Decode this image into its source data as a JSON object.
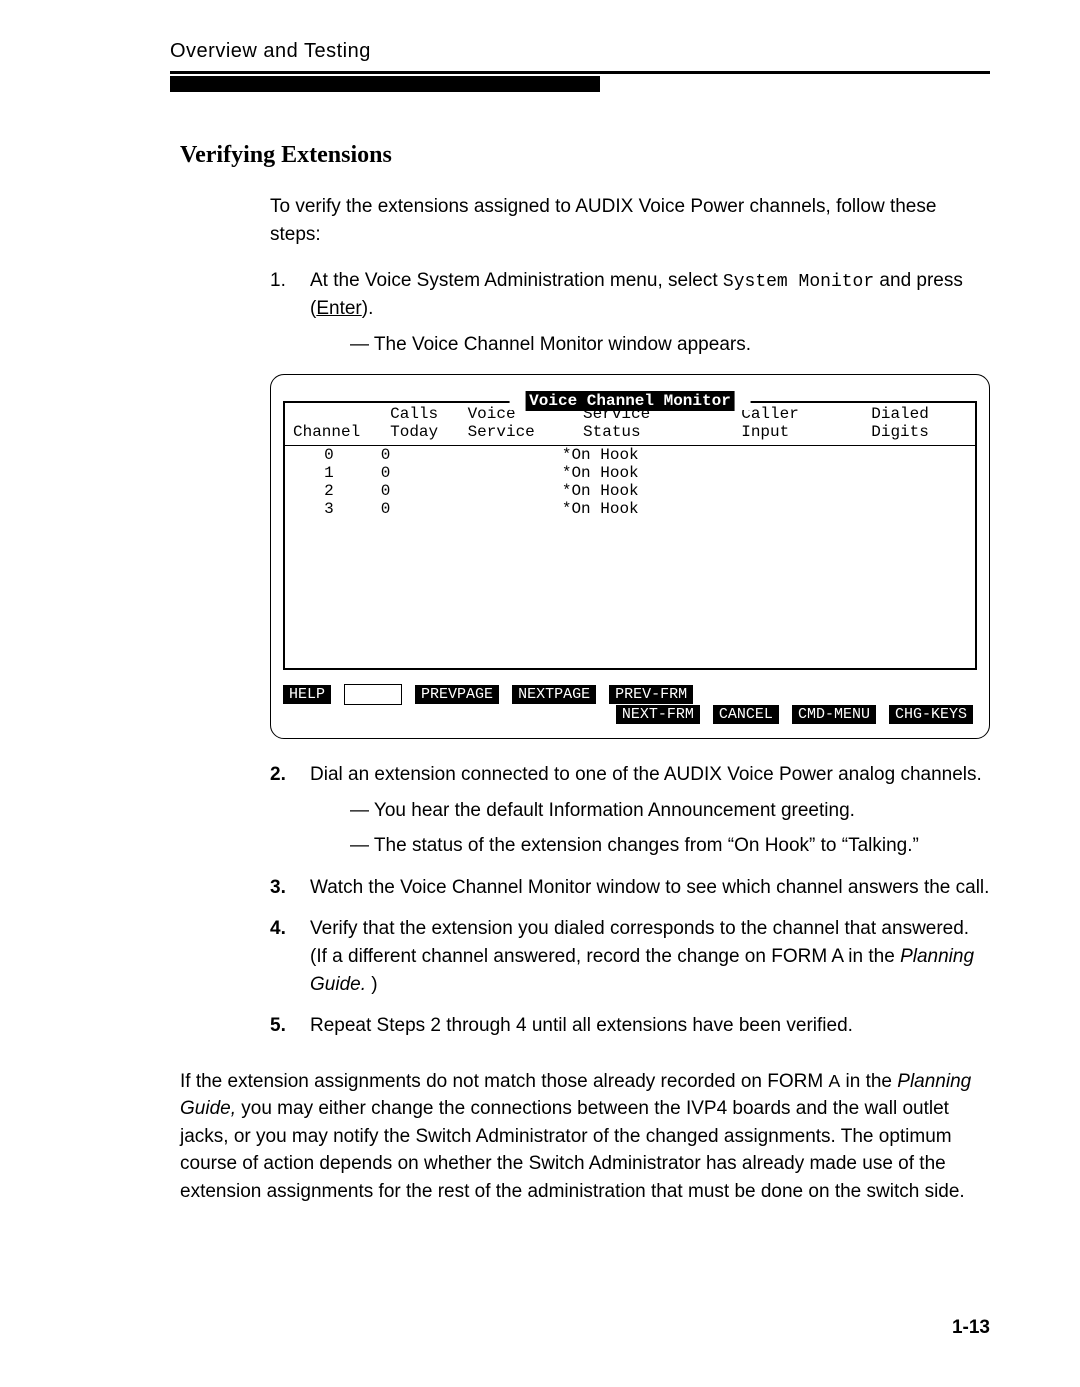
{
  "running_header": "Overview and Testing",
  "section_heading": "Verifying Extensions",
  "intro": "To verify the extensions assigned to AUDIX Voice Power channels, follow these steps:",
  "steps": [
    {
      "num": "1.",
      "num_weight": "light",
      "text_pre": "At the Voice System Administration menu, select ",
      "code": "System Monitor",
      "text_mid": " and press (",
      "link": "Enter",
      "text_post": ").",
      "sub": [
        "— The Voice Channel Monitor window appears."
      ]
    },
    {
      "num": "2.",
      "num_weight": "bold",
      "text_pre": "Dial an extension connected to one of the AUDIX Voice Power analog channels.",
      "sub": [
        "— You hear the default Information Announcement greeting.",
        "— The status of the extension changes from “On Hook” to “Talking.”"
      ]
    },
    {
      "num": "3.",
      "num_weight": "bold",
      "text_pre": "Watch the Voice Channel Monitor window to see which channel answers the call."
    },
    {
      "num": "4.",
      "num_weight": "bold",
      "text_pre": "Verify that the extension you dialed corresponds to the channel that answered. (If a different channel answered, record the change on FORM A in the ",
      "italic": "Planning Guide.",
      "text_post": " )"
    },
    {
      "num": "5.",
      "num_weight": "bold",
      "text_pre": "Repeat Steps 2 through 4 until all extensions have been verified."
    }
  ],
  "closing_para": {
    "pre": "If the extension assignments do not match those already recorded on FORM ",
    "sc": "A",
    "mid": " in the ",
    "italic": "Planning Guide,",
    "post": " you may either change the connections between the IVP4 boards and the wall outlet jacks, or you may notify the Switch Administrator of the changed assignments. The optimum course of action depends on whether the Switch Administrator has already made use of the extension assignments for the rest of the administration that must be done on the switch side."
  },
  "page_number": "1-13",
  "terminal": {
    "title": "Voice Channel Monitor",
    "columns": [
      "Channel",
      "Calls Today",
      "Voice Service",
      "Service Status",
      "Caller Input",
      "Dialed Digits"
    ],
    "rows": [
      {
        "channel": "0",
        "calls": "0",
        "voice": "",
        "status": "*On Hook",
        "caller": "",
        "dialed": ""
      },
      {
        "channel": "1",
        "calls": "0",
        "voice": "",
        "status": "*On Hook",
        "caller": "",
        "dialed": ""
      },
      {
        "channel": "2",
        "calls": "0",
        "voice": "",
        "status": "*On Hook",
        "caller": "",
        "dialed": ""
      },
      {
        "channel": "3",
        "calls": "0",
        "voice": "",
        "status": "*On Hook",
        "caller": "",
        "dialed": ""
      }
    ],
    "fkeys_left": [
      "HELP",
      "",
      "PREVPAGE",
      "NEXTPAGE",
      "PREV-FRM"
    ],
    "fkeys_right": [
      "NEXT-FRM",
      "CANCEL",
      "CMD-MENU",
      "CHG-KEYS"
    ]
  }
}
